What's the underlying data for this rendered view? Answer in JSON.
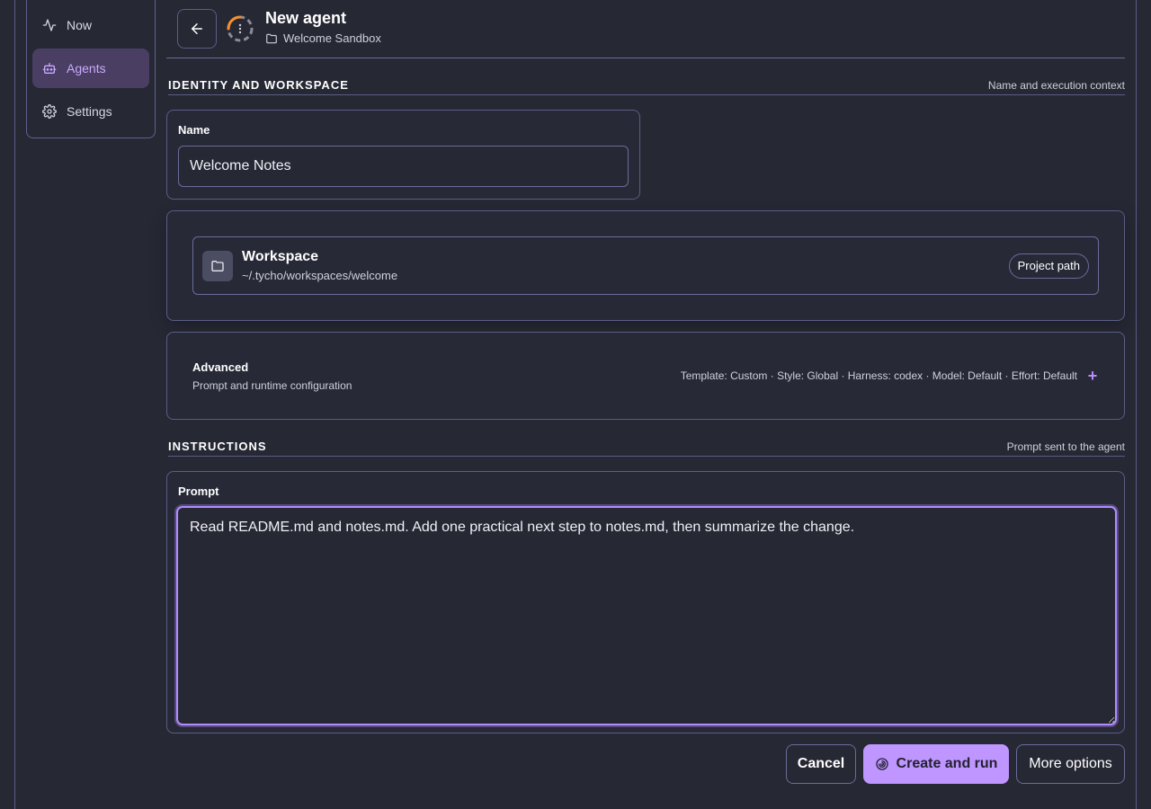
{
  "sidebar": {
    "items": [
      {
        "label": "Now",
        "icon": "activity-icon",
        "active": false
      },
      {
        "label": "Agents",
        "icon": "robot-icon",
        "active": true
      },
      {
        "label": "Settings",
        "icon": "gear-icon",
        "active": false
      }
    ]
  },
  "header": {
    "title": "New agent",
    "breadcrumb": "Welcome Sandbox"
  },
  "identity": {
    "title": "IDENTITY AND WORKSPACE",
    "subtitle": "Name and execution context",
    "name_label": "Name",
    "name_value": "Welcome Notes",
    "workspace_title": "Workspace",
    "workspace_path": "~/.tycho/workspaces/welcome",
    "workspace_pill": "Project path"
  },
  "advanced": {
    "title": "Advanced",
    "subtitle": "Prompt and runtime configuration",
    "summary": "Template: Custom · Style: Global · Harness: codex · Model: Default · Effort: Default",
    "expand_symbol": "+"
  },
  "instructions": {
    "title": "INSTRUCTIONS",
    "subtitle": "Prompt sent to the agent",
    "prompt_label": "Prompt",
    "prompt_value": "Read README.md and notes.md. Add one practical next step to notes.md, then summarize the change."
  },
  "actions": {
    "cancel": "Cancel",
    "create": "Create and run",
    "more": "More options"
  },
  "colors": {
    "background": "#262834",
    "border": "#5b5d86",
    "accent": "#bf95ff",
    "active_nav_bg": "#4a3f63",
    "spinner_orange": "#f2912d"
  }
}
